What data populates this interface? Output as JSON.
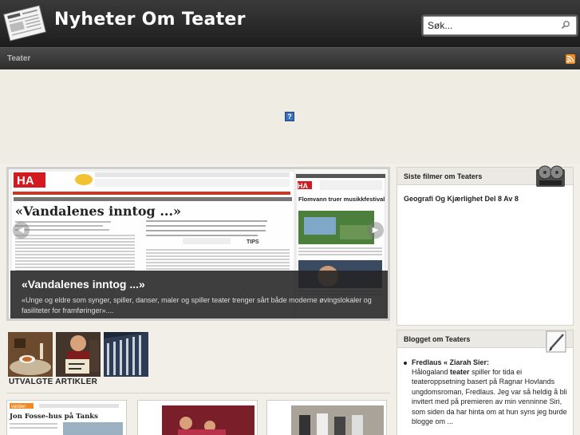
{
  "site": {
    "title": "Nyheter Om Teater"
  },
  "search": {
    "value": "Søk..."
  },
  "nav": {
    "item": "Teater"
  },
  "slider": {
    "title": "«Vandalenes inntog ...»",
    "description": "«Unge og eldre som synger, spiller, danser, maler og spiller teater trenger sårt både moderne øvingslokaler og fasiliteter for framføringer»....",
    "newspaper": {
      "masthead": "HA",
      "headline": "«Vandalenes inntog ...»",
      "subheadline": "«Unge og eldre som synger, spiller, danser, maler og spiller teater trenger sårt både moderne øvingslokaler og fasiliteter for framføringer».",
      "side_masthead": "HA",
      "side_headline": "Flomvann truer musikkfestival",
      "tips": "TIPS"
    }
  },
  "articles": {
    "heading": "UTVALGTE ARTIKLER",
    "card1_title": "Jon Fosse-hus på Tanks",
    "card1_paper": "varden"
  },
  "widgets": {
    "films": {
      "title": "Siste filmer om Teaters",
      "item": "Geografi Og Kjærlighet Del 8 Av 8"
    },
    "blog": {
      "title": "Blogget om Teaters",
      "entry_title": "Fredlaus « Ziarah Sier:",
      "entry_pre": "Hålogaland ",
      "entry_keyword": "teater",
      "entry_post": " spiller for tida ei teateroppsetning basert på Ragnar Hovlands ungdomsroman, Fredlaus. Jeg var så heldig å bli invitert med på premieren av min venninne Siri, som siden da har hinta om at hun syns jeg burde blogge om ..."
    }
  },
  "icons": {
    "logo": "newspaper-logo-icon",
    "search": "search-icon",
    "rss": "rss-icon",
    "prev": "chevron-left-icon",
    "next": "chevron-right-icon",
    "film": "film-reel-icon",
    "pencil": "pencil-icon"
  },
  "colors": {
    "header": "#262626",
    "nav": "#3b3b3b",
    "page": "#f1efe8",
    "rss": "#f08a24",
    "newspaper_red": "#d41920"
  }
}
